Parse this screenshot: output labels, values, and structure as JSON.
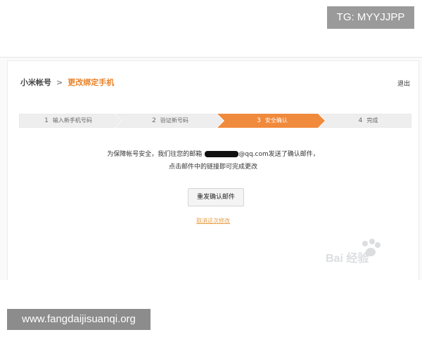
{
  "overlay": {
    "tg_label": "TG: MYYJJPP",
    "site_label": "www.fangdaijisuanqi.org"
  },
  "header": {
    "account": "小米帐号",
    "separator": ">",
    "current": "更改绑定手机",
    "logout": "退出"
  },
  "steps": [
    {
      "num": "1",
      "label": "输入新手机号码"
    },
    {
      "num": "2",
      "label": "验证新号码"
    },
    {
      "num": "3",
      "label": "安全确认"
    },
    {
      "num": "4",
      "label": "完成"
    }
  ],
  "message": {
    "line1_prefix": "为保障帐号安全，我们往您的邮箱",
    "line1_suffix": "@qq.com发送了确认邮件，",
    "line2": "点击邮件中的链接即可完成更改"
  },
  "actions": {
    "resend": "重发确认邮件",
    "cancel": "取消这次修改"
  },
  "watermark": {
    "text": "Bai 经验"
  },
  "colors": {
    "accent": "#f08a3c",
    "step_inactive": "#eeeeee"
  }
}
